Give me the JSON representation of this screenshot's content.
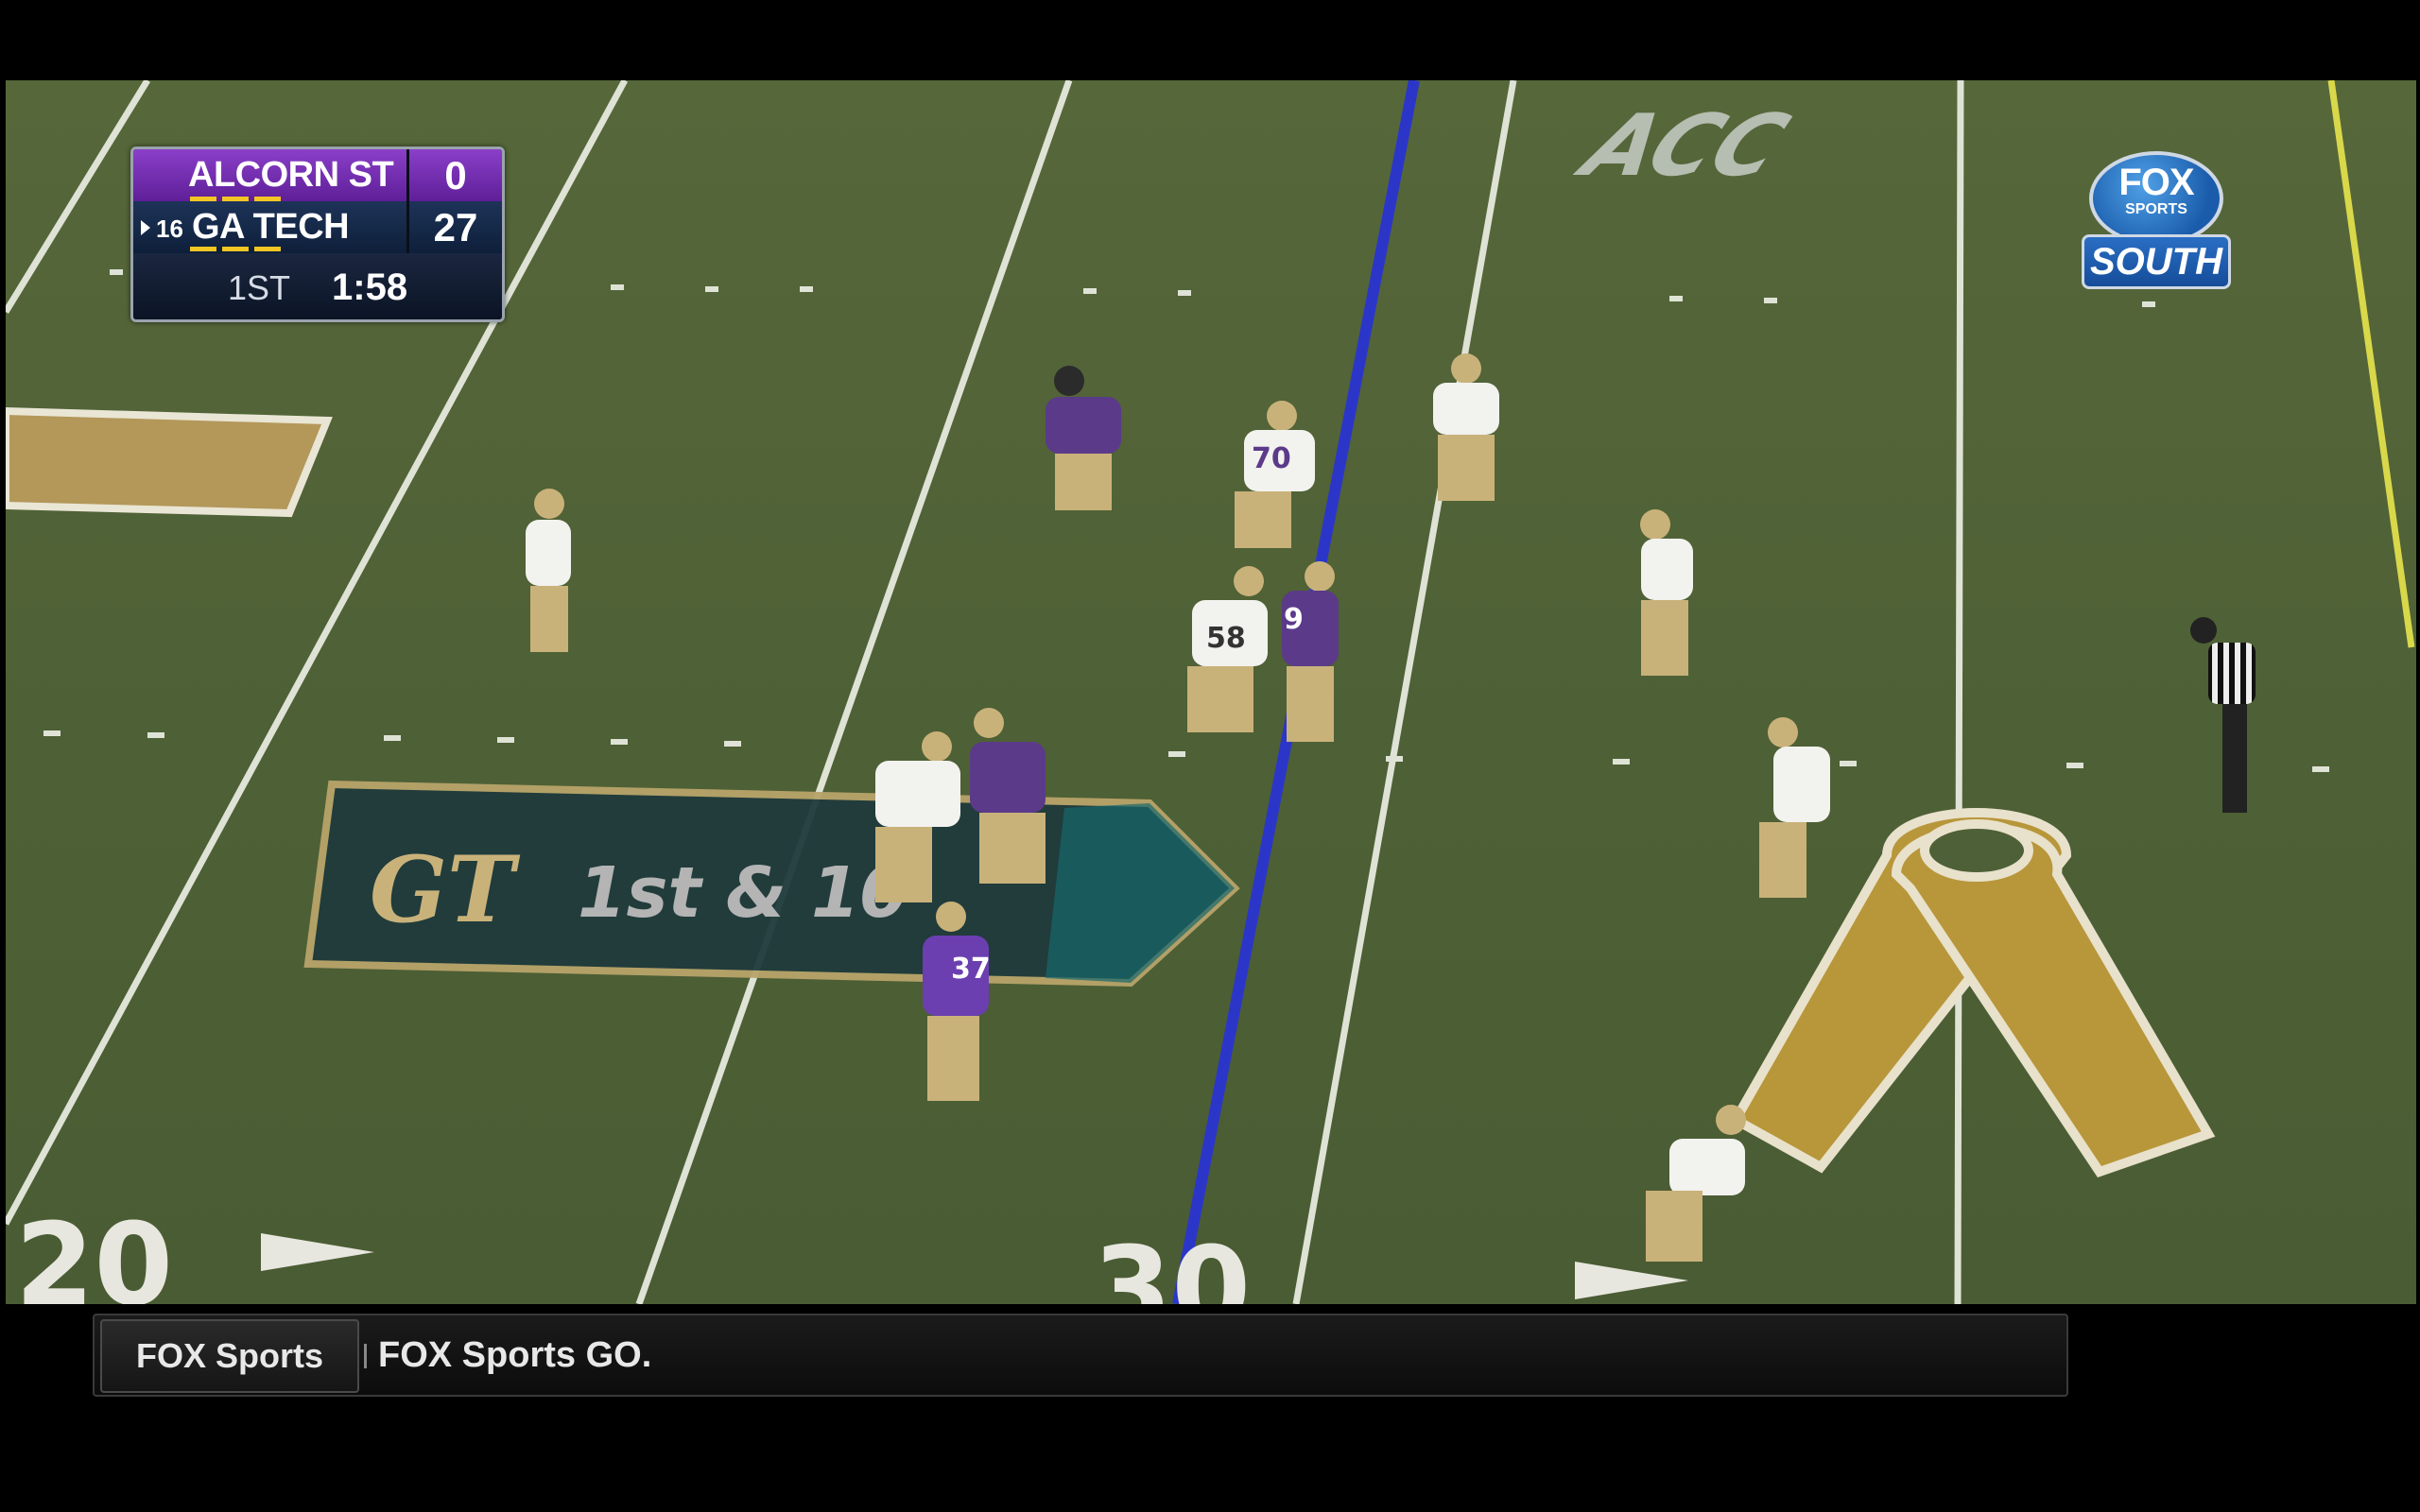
{
  "scorebug": {
    "away": {
      "team": "ALCORN ST",
      "score": "0"
    },
    "home": {
      "rank": "16",
      "team": "GA TECH",
      "score": "27"
    },
    "quarter": "1ST",
    "clock": "1:58"
  },
  "network": {
    "brand": "FOX",
    "sub": "SPORTS",
    "region": "SOUTH"
  },
  "field": {
    "conference_logo": "ACC",
    "down_marker_logo": "GT",
    "down_distance": "1st & 10",
    "yard_numbers": [
      "20",
      "30"
    ],
    "jersey_numbers": [
      "70",
      "58",
      "9",
      "37"
    ]
  },
  "ticker": {
    "tag": "FOX Sports",
    "text": "FOX Sports GO."
  },
  "colors": {
    "first_down_line": "#2b36c9",
    "turf": "#52653a",
    "ribbon": "#b8963a",
    "away_bar": "#7b34b8"
  }
}
